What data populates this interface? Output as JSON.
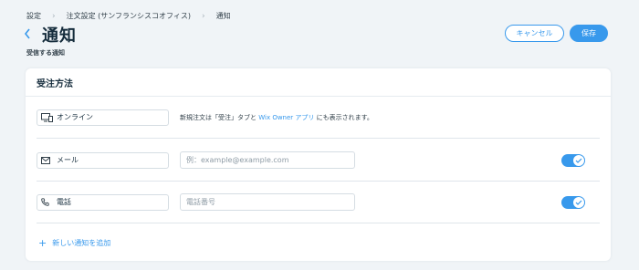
{
  "breadcrumb": {
    "items": [
      "設定",
      "注文設定 (サンフランシスコオフィス)",
      "通知"
    ],
    "separator": "›"
  },
  "header": {
    "back_icon": "chevron-left-icon",
    "title": "通知",
    "subtitle": "受信する通知",
    "cancel_label": "キャンセル",
    "save_label": "保存"
  },
  "card": {
    "title": "受注方法",
    "rows": [
      {
        "channel": "オンライン",
        "icon": "desktop-mobile-icon",
        "note_before": "新規注文は「受注」タブと ",
        "note_link": "Wix Owner アプリ",
        "note_after": " にも表示されます。"
      },
      {
        "channel": "メール",
        "icon": "envelope-icon",
        "placeholder": "例：example@example.com",
        "toggle_on": true
      },
      {
        "channel": "電話",
        "icon": "phone-icon",
        "placeholder": "電話番号",
        "toggle_on": true
      }
    ],
    "add_label": "新しい通知を追加"
  },
  "colors": {
    "accent": "#3899ec",
    "background": "#f0f4f7",
    "title": "#162d3d"
  }
}
